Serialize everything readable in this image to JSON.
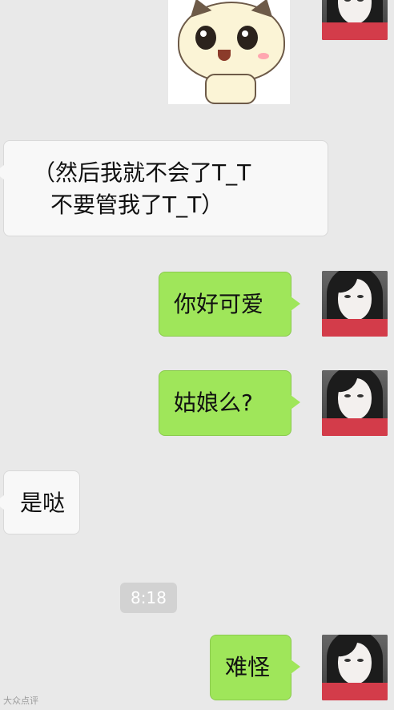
{
  "messages": [
    {
      "id": "m1",
      "side": "right",
      "type": "sticker",
      "sticker_name": "cute-cat-sticker"
    },
    {
      "id": "m2",
      "side": "left",
      "type": "text",
      "lines": [
        "（然后我就不会了T_T",
        "不要管我了T_T）"
      ]
    },
    {
      "id": "m3",
      "side": "right",
      "type": "text",
      "text": "你好可爱"
    },
    {
      "id": "m4",
      "side": "right",
      "type": "text",
      "text": "姑娘么?"
    },
    {
      "id": "m5",
      "side": "left",
      "type": "text",
      "text": "是哒"
    },
    {
      "id": "m6",
      "side": "right",
      "type": "text",
      "text": "难怪"
    }
  ],
  "timestamp": "8:18",
  "watermark": "大众点评",
  "colors": {
    "background": "#e9e9e9",
    "outgoing_bubble": "#9fe65a",
    "incoming_bubble": "#f8f8f8",
    "timestamp_bg": "#d2d2d2"
  }
}
